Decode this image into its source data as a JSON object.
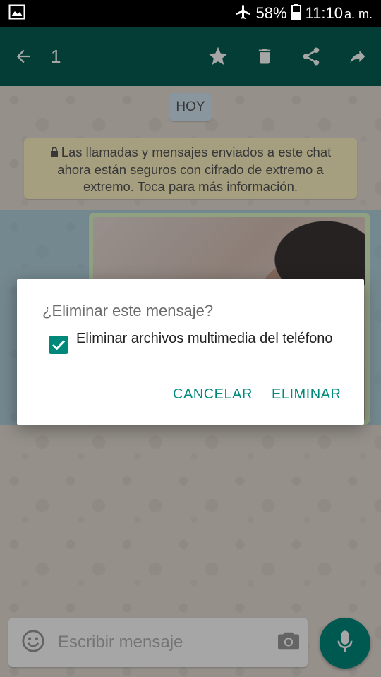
{
  "status_bar": {
    "battery": "58%",
    "time": "11:10",
    "ampm": "a. m.",
    "icons": [
      "gallery-icon",
      "airplane-mode-icon",
      "battery-icon"
    ]
  },
  "toolbar": {
    "selected_count": "1",
    "icons": [
      "back-arrow-icon",
      "star-icon",
      "delete-icon",
      "share-icon",
      "forward-icon"
    ],
    "color": "#075e54"
  },
  "chat": {
    "date_chip": "HOY",
    "encryption_notice": "Las llamadas y mensajes enviados a este chat ahora están seguros con cifrado de extremo a extremo. Toca para más información."
  },
  "dialog": {
    "title": "¿Eliminar este mensaje?",
    "option_label": "Eliminar archivos multimedia del teléfono",
    "option_checked": true,
    "cancel_label": "CANCELAR",
    "delete_label": "ELIMINAR",
    "accent_color": "#00897b"
  },
  "composer": {
    "placeholder": "Escribir mensaje",
    "icons": [
      "emoji-icon",
      "camera-icon",
      "mic-icon"
    ]
  }
}
